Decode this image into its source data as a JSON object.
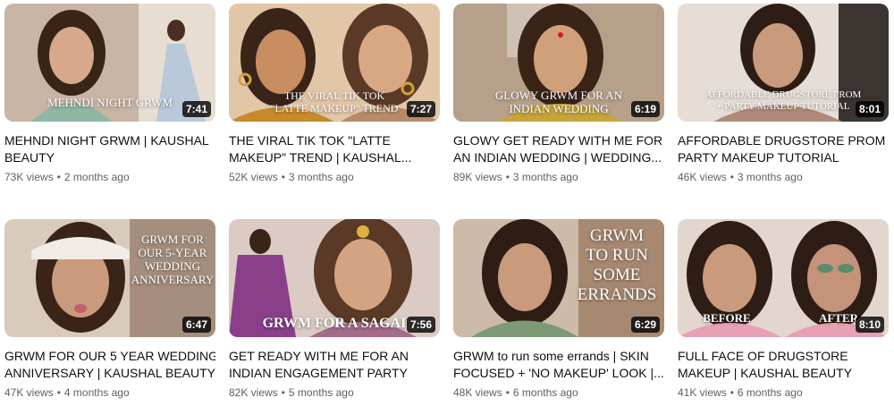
{
  "videos": [
    {
      "title_lines": [
        "MEHNDI NIGHT GRWM | KAUSHAL",
        "BEAUTY"
      ],
      "views": "73K views",
      "age": "2 months ago",
      "duration": "7:41",
      "overlay": [
        "MEHNDI NIGHT GRWM"
      ],
      "bg": [
        "#b89a86",
        "#e8ddd2"
      ]
    },
    {
      "title_lines": [
        "THE VIRAL TIK TOK \"LATTE",
        "MAKEUP\" TREND | KAUSHAL..."
      ],
      "views": "52K views",
      "age": "3 months ago",
      "duration": "7:27",
      "overlay": [
        "THE VIRAL TIK TOK",
        "\"LATTE MAKEUP\" TREND"
      ],
      "bg": [
        "#c89368",
        "#e4c7a6"
      ]
    },
    {
      "title_lines": [
        "GLOWY GET READY WITH ME FOR",
        "AN INDIAN WEDDING | WEDDING..."
      ],
      "views": "89K views",
      "age": "3 months ago",
      "duration": "6:19",
      "overlay": [
        "GLOWY GRWM FOR AN",
        "INDIAN WEDDING"
      ],
      "bg": [
        "#9c7a5e",
        "#cfae8f"
      ]
    },
    {
      "title_lines": [
        "AFFORDABLE DRUGSTORE PROM +",
        "PARTY MAKEUP TUTORIAL"
      ],
      "views": "46K views",
      "age": "3 months ago",
      "duration": "8:01",
      "overlay": [
        "AFFORDABLE DRUGSTORE PROM",
        "+ PARTY MAKEUP TUTORIAL"
      ],
      "bg": [
        "#a38b7c",
        "#e6ddd7"
      ]
    },
    {
      "title_lines": [
        "GRWM FOR OUR 5 YEAR WEDDING",
        "ANNIVERSARY | KAUSHAL BEAUTY"
      ],
      "views": "47K views",
      "age": "4 months ago",
      "duration": "6:47",
      "overlay": [
        "GRWM FOR",
        "OUR 5-YEAR",
        "WEDDING",
        "ANNIVERSARY"
      ],
      "bg": [
        "#8e7563",
        "#d8cbbd"
      ]
    },
    {
      "title_lines": [
        "GET READY WITH ME FOR AN",
        "INDIAN ENGAGEMENT PARTY"
      ],
      "views": "82K views",
      "age": "5 months ago",
      "duration": "7:56",
      "overlay": [
        "GRWM FOR A SAGAI"
      ],
      "bg": [
        "#8a4a86",
        "#d9c5c7"
      ]
    },
    {
      "title_lines": [
        "GRWM to run some errands | SKIN",
        "FOCUSED + 'NO MAKEUP' LOOK |..."
      ],
      "views": "48K views",
      "age": "6 months ago",
      "duration": "6:29",
      "overlay": [
        "GRWM",
        "TO RUN",
        "SOME",
        "ERRANDS"
      ],
      "bg": [
        "#a78972",
        "#d6c3b2"
      ]
    },
    {
      "title_lines": [
        "FULL FACE OF DRUGSTORE",
        "MAKEUP | KAUSHAL BEAUTY"
      ],
      "views": "41K views",
      "age": "6 months ago",
      "duration": "8:10",
      "overlay": [
        "BEFORE",
        "AFTER"
      ],
      "bg": [
        "#a88a78",
        "#e3d6cf"
      ]
    }
  ]
}
